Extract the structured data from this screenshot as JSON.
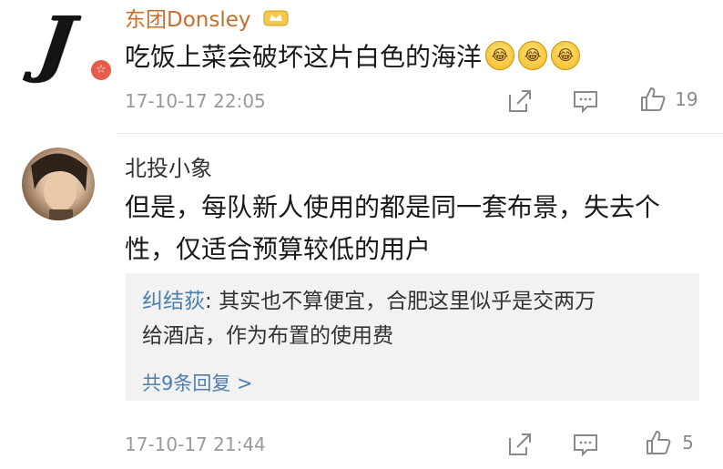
{
  "comments": [
    {
      "username": "东团Donsley",
      "body": "吃饭上菜会破坏这片白色的海洋",
      "emojis": [
        "laugh-cry-emoji",
        "laugh-cry-emoji",
        "laugh-cry-emoji"
      ],
      "timestamp": "17-10-17 22:05",
      "likes": "19",
      "avatar_letter": "J"
    },
    {
      "username": "北投小象",
      "body_line1": "但是，每队新人使用的都是同一套布景，失去个",
      "body_line2": "性，仅适合预算较低的用户",
      "reply": {
        "name": "纠结荻",
        "separator": ": ",
        "text_line1": "其实也不算便宜，合肥这里似乎是交两万",
        "text_line2": "给酒店，作为布置的使用费",
        "more": "共9条回复 >"
      },
      "timestamp": "17-10-17 21:44",
      "likes": "5"
    }
  ],
  "colors": {
    "username_accent": "#c96d2a",
    "link_blue": "#4c7fb0",
    "meta_gray": "#9a9a9a"
  }
}
